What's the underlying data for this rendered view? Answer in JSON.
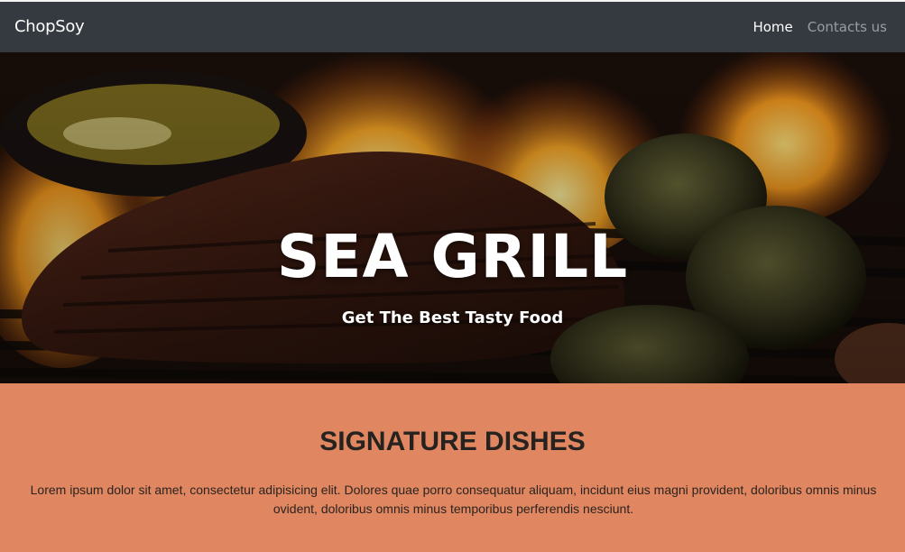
{
  "navbar": {
    "brand": "ChopSoy",
    "links": [
      {
        "label": "Home",
        "active": true
      },
      {
        "label": "Contacts us",
        "active": false
      }
    ]
  },
  "hero": {
    "title": "SEA GRILL",
    "subtitle": "Get The Best Tasty Food"
  },
  "signature": {
    "title": "SIGNATURE DISHES",
    "text": "Lorem ipsum dolor sit amet, consectetur adipisicing elit. Dolores quae porro consequatur aliquam, incidunt eius magni provident, doloribus omnis minus ovident, doloribus omnis minus temporibus perferendis nesciunt."
  },
  "colors": {
    "navbar": "#343a40",
    "section_bg": "#e08660",
    "heading_text": "#262220"
  }
}
